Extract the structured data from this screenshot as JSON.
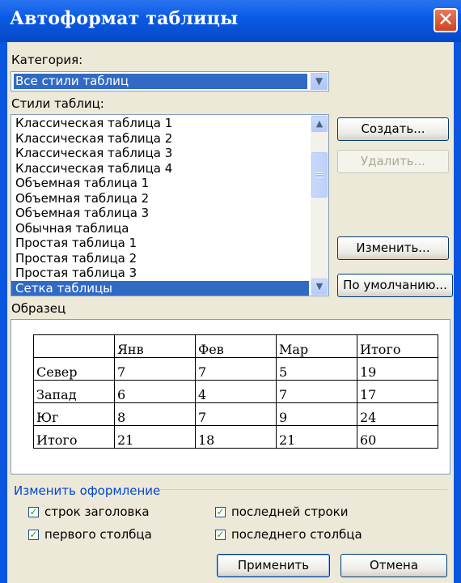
{
  "window": {
    "title": "Автоформат таблицы",
    "close_glyph": "✕"
  },
  "category": {
    "label": "Категория:",
    "selected": "Все стили таблиц"
  },
  "styles": {
    "label": "Стили таблиц:",
    "items": [
      "Классическая таблица 1",
      "Классическая таблица 2",
      "Классическая таблица 3",
      "Классическая таблица 4",
      "Объемная таблица 1",
      "Объемная таблица 2",
      "Объемная таблица 3",
      "Обычная таблица",
      "Простая таблица 1",
      "Простая таблица 2",
      "Простая таблица 3",
      "Сетка таблицы"
    ],
    "selected_index": 11
  },
  "buttons": {
    "create": "Создать...",
    "delete": "Удалить...",
    "modify": "Изменить...",
    "default": "По умолчанию...",
    "apply": "Применить",
    "cancel": "Отмена"
  },
  "preview": {
    "label": "Образец",
    "rows": [
      [
        "",
        "Янв",
        "Фев",
        "Мар",
        "Итого"
      ],
      [
        "Север",
        "7",
        "7",
        "5",
        "19"
      ],
      [
        "Запад",
        "6",
        "4",
        "7",
        "17"
      ],
      [
        "Юг",
        "8",
        "7",
        "9",
        "24"
      ],
      [
        "Итого",
        "21",
        "18",
        "21",
        "60"
      ]
    ]
  },
  "apply_to": {
    "label": "Изменить оформление",
    "checkboxes": [
      {
        "label": "строк заголовка",
        "checked": true
      },
      {
        "label": "последней строки",
        "checked": true
      },
      {
        "label": "первого столбца",
        "checked": true
      },
      {
        "label": "последнего столбца",
        "checked": true
      }
    ]
  },
  "colors": {
    "title_bar": "#0b5be6",
    "selection": "#316ac5",
    "face": "#ece9d8",
    "group_label": "#0046d5"
  }
}
